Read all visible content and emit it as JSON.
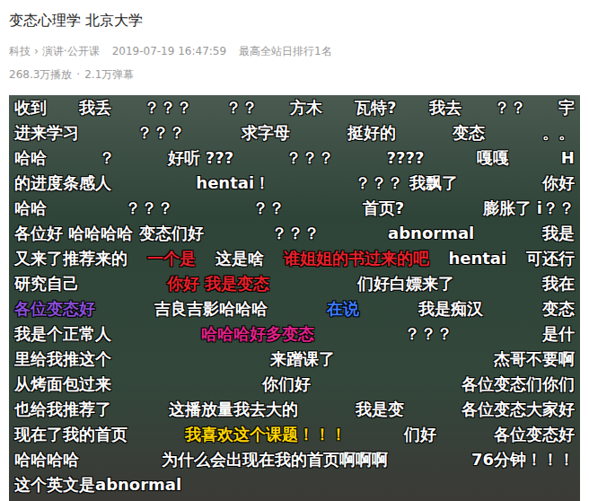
{
  "page": {
    "title": "变态心理学 北京大学",
    "breadcrumb": [
      "科技",
      "演讲·公开课"
    ],
    "breadcrumb_separator": "›",
    "date": "2019-07-19 16:47:59",
    "rank": "最高全站日排行1名",
    "stats": [
      "268.3万播放",
      "·",
      "2.1万弹幕"
    ]
  },
  "danmaku_rows": [
    [
      {
        "text": "收到",
        "color": "#ffffff"
      },
      {
        "text": "我丢",
        "color": "#ffffff"
      },
      {
        "text": "？？？",
        "color": "#ffffff"
      },
      {
        "text": "？？",
        "color": "#ffffff"
      },
      {
        "text": "方木",
        "color": "#ffffff"
      },
      {
        "text": "瓦特?",
        "color": "#ffffff"
      },
      {
        "text": "我去",
        "color": "#ffffff"
      },
      {
        "text": "？？",
        "color": "#ffffff"
      },
      {
        "text": "宇",
        "color": "#ffffff"
      }
    ],
    [
      {
        "text": "进来学习",
        "color": "#ffffff"
      },
      {
        "text": "？？？",
        "color": "#ffffff"
      },
      {
        "text": "求字母",
        "color": "#ffffff"
      },
      {
        "text": "挺好的",
        "color": "#ffffff"
      },
      {
        "text": "变态",
        "color": "#ffffff"
      },
      {
        "text": "。。",
        "color": "#ffffff"
      }
    ],
    [
      {
        "text": "哈哈",
        "color": "#ffffff"
      },
      {
        "text": "？",
        "color": "#ffffff"
      },
      {
        "text": "好听 ???",
        "color": "#ffffff"
      },
      {
        "text": "？？？",
        "color": "#ffffff"
      },
      {
        "text": "????",
        "color": "#ffffff"
      },
      {
        "text": "嘎嘎",
        "color": "#ffffff"
      },
      {
        "text": "H",
        "color": "#ffffff"
      }
    ],
    [
      {
        "text": "的进度条感人",
        "color": "#ffffff"
      },
      {
        "text": "hentai！",
        "color": "#ffffff"
      },
      {
        "text": "？？？ 我飘了",
        "color": "#ffffff"
      },
      {
        "text": "你好",
        "color": "#ffffff"
      }
    ],
    [
      {
        "text": "哈哈",
        "color": "#ffffff"
      },
      {
        "text": "？？？",
        "color": "#ffffff"
      },
      {
        "text": "？？",
        "color": "#ffffff"
      },
      {
        "text": "首页?",
        "color": "#ffffff"
      },
      {
        "text": "膨胀了 i？？",
        "color": "#ffffff"
      }
    ],
    [
      {
        "text": "各位好 哈哈哈哈 变态们好",
        "color": "#ffffff"
      },
      {
        "text": "？？？",
        "color": "#ffffff"
      },
      {
        "text": "abnormal",
        "color": "#ffffff"
      },
      {
        "text": "我是",
        "color": "#ffffff"
      }
    ],
    [
      {
        "text": "又来了推荐来的",
        "color": "#ffffff"
      },
      {
        "text": "一个是",
        "color": "#e8202a"
      },
      {
        "text": "这是啥",
        "color": "#ffffff"
      },
      {
        "text": "谁姐姐的书过来的吧",
        "color": "#e8202a"
      },
      {
        "text": "hentai",
        "color": "#ffffff"
      },
      {
        "text": "可还行",
        "color": "#ffffff"
      }
    ],
    [
      {
        "text": "研究自己",
        "color": "#ffffff"
      },
      {
        "text": "你好 我是变态",
        "color": "#e8202a"
      },
      {
        "text": "们好白嫖来了",
        "color": "#ffffff"
      },
      {
        "text": "我在",
        "color": "#ffffff"
      }
    ],
    [
      {
        "text": "各位变态好",
        "color": "#8a4fd6"
      },
      {
        "text": "吉良吉影哈哈哈",
        "color": "#ffffff"
      },
      {
        "text": "在说",
        "color": "#3b7cff"
      },
      {
        "text": "我是痴汉",
        "color": "#ffffff"
      },
      {
        "text": "变态",
        "color": "#ffffff"
      }
    ],
    [
      {
        "text": "我是个正常人",
        "color": "#ffffff"
      },
      {
        "text": "哈哈哈好多变态",
        "color": "#e0218a"
      },
      {
        "text": "？？？",
        "color": "#ffffff"
      },
      {
        "text": "是什",
        "color": "#ffffff"
      }
    ],
    [
      {
        "text": "里给我推这个",
        "color": "#ffffff"
      },
      {
        "text": "来蹭课了",
        "color": "#ffffff"
      },
      {
        "text": "杰哥不要啊",
        "color": "#ffffff"
      }
    ],
    [
      {
        "text": "从烤面包过来",
        "color": "#ffffff"
      },
      {
        "text": "你们好",
        "color": "#ffffff"
      },
      {
        "text": "各位变态们你们",
        "color": "#ffffff"
      }
    ],
    [
      {
        "text": "也给我推荐了",
        "color": "#ffffff"
      },
      {
        "text": "这播放量我去大的",
        "color": "#ffffff"
      },
      {
        "text": "我是变",
        "color": "#ffffff"
      },
      {
        "text": "各位变态大家好",
        "color": "#ffffff"
      }
    ],
    [
      {
        "text": "现在了我的首页",
        "color": "#ffffff"
      },
      {
        "text": "我喜欢这个课题！！！",
        "color": "#ffd700"
      },
      {
        "text": "们好",
        "color": "#ffffff"
      },
      {
        "text": "各位变态好",
        "color": "#ffffff"
      }
    ],
    [
      {
        "text": "哈哈哈哈",
        "color": "#ffffff"
      },
      {
        "text": "为什么会出现在我的首页啊啊啊",
        "color": "#ffffff"
      },
      {
        "text": "76分钟！！！",
        "color": "#ffffff"
      }
    ],
    [
      {
        "text": "这个英文是abnormal",
        "color": "#ffffff"
      }
    ]
  ]
}
